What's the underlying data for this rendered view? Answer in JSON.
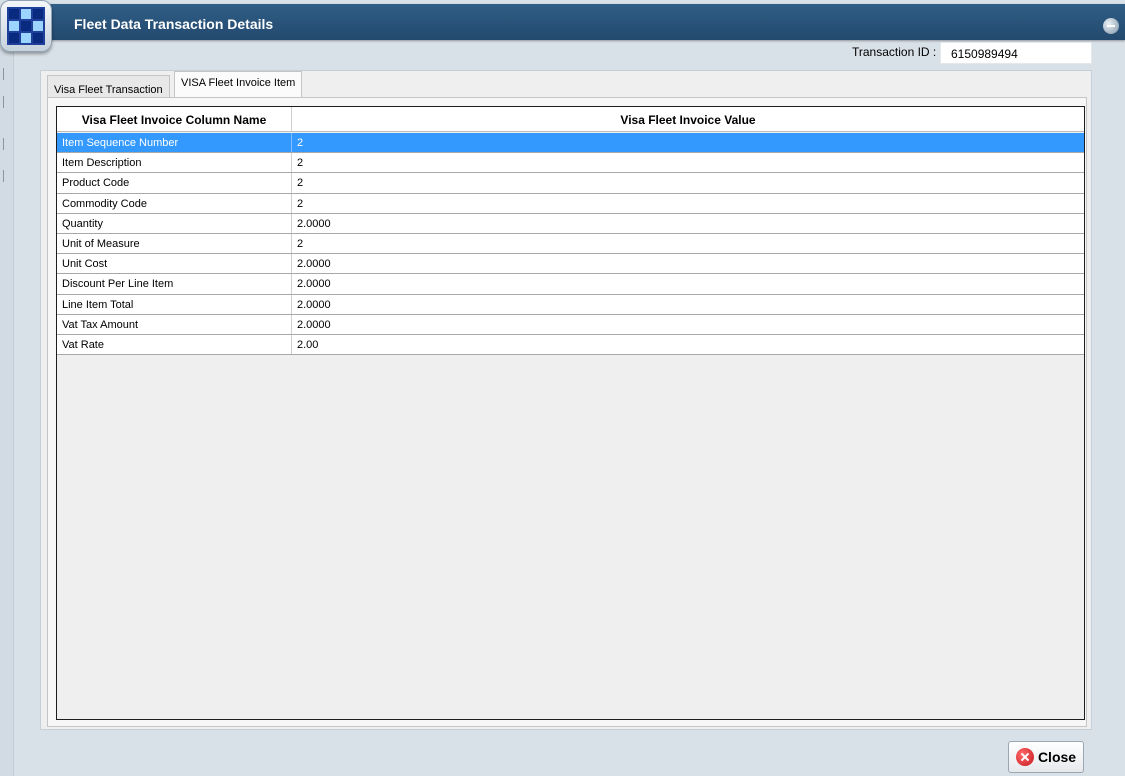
{
  "window": {
    "title": "Fleet Data Transaction Details",
    "logo_icon": "app-grid-logo",
    "minimize_icon": "minimize-icon",
    "close_icon": "close-window-icon"
  },
  "transaction": {
    "label": "Transaction ID :",
    "value": "6150989494"
  },
  "tabs": [
    {
      "label": "Visa Fleet Transaction",
      "active": false
    },
    {
      "label": "VISA Fleet Invoice Item",
      "active": true
    }
  ],
  "grid": {
    "columns": [
      "Visa Fleet Invoice Column Name",
      "Visa Fleet Invoice Value"
    ],
    "rows": [
      {
        "name": "Item Sequence Number",
        "value": "2",
        "selected": true
      },
      {
        "name": "Item Description",
        "value": "2"
      },
      {
        "name": "Product Code",
        "value": "2"
      },
      {
        "name": "Commodity Code",
        "value": "2"
      },
      {
        "name": "Quantity",
        "value": "2.0000"
      },
      {
        "name": "Unit of Measure",
        "value": "2"
      },
      {
        "name": "Unit Cost",
        "value": "2.0000"
      },
      {
        "name": "Discount Per Line Item",
        "value": "2.0000"
      },
      {
        "name": "Line Item Total",
        "value": "2.0000"
      },
      {
        "name": "Vat Tax Amount",
        "value": "2.0000"
      },
      {
        "name": "Vat Rate",
        "value": "2.00"
      }
    ],
    "selected_color": "#3399ff"
  },
  "footer": {
    "close_label": "Close",
    "close_icon": "close-circle-icon"
  }
}
